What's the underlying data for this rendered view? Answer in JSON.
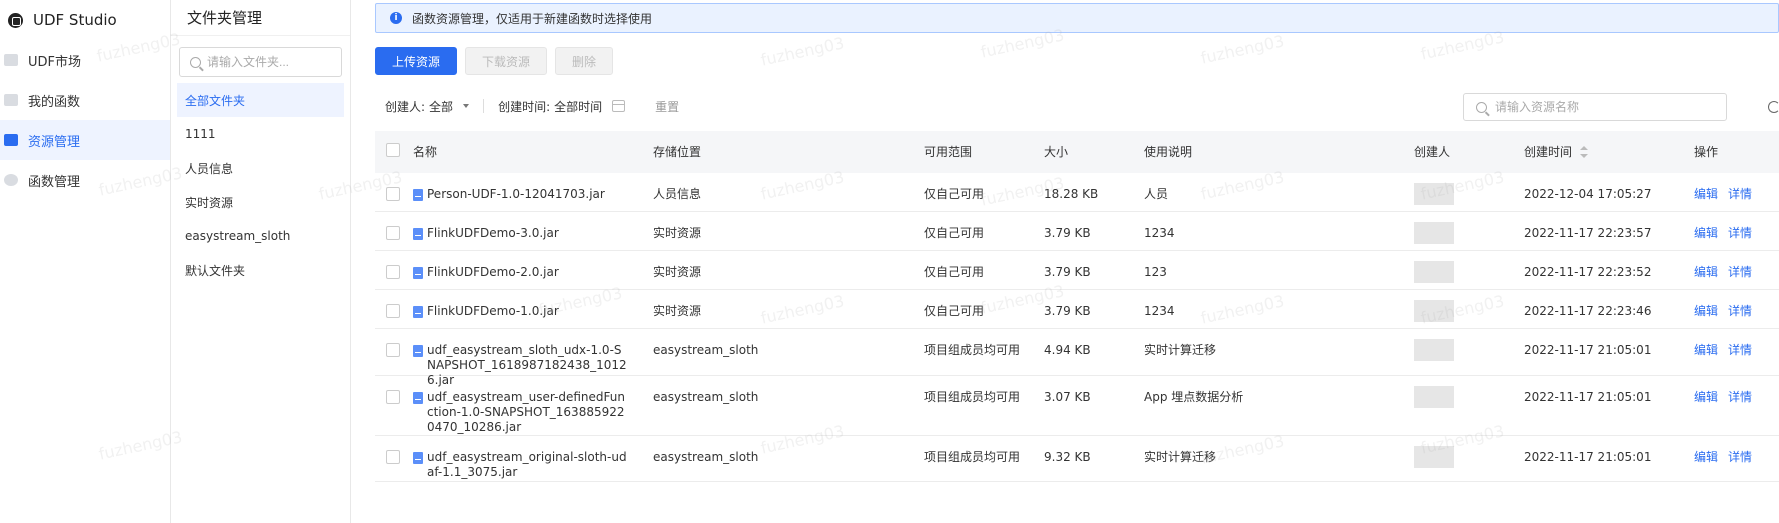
{
  "nav": {
    "brand": "UDF Studio",
    "items": [
      {
        "label": "UDF市场",
        "active": false
      },
      {
        "label": "我的函数",
        "active": false
      },
      {
        "label": "资源管理",
        "active": true
      },
      {
        "label": "函数管理",
        "active": false
      }
    ]
  },
  "folders": {
    "title": "文件夹管理",
    "search_placeholder": "请输入文件夹...",
    "items": [
      {
        "label": "全部文件夹",
        "active": true
      },
      {
        "label": "1111",
        "active": false
      },
      {
        "label": "人员信息",
        "active": false
      },
      {
        "label": "实时资源",
        "active": false
      },
      {
        "label": "easystream_sloth",
        "active": false
      },
      {
        "label": "默认文件夹",
        "active": false
      }
    ]
  },
  "banner": {
    "text": "函数资源管理，仅适用于新建函数时选择使用"
  },
  "toolbar": {
    "upload": "上传资源",
    "download": "下载资源",
    "delete": "删除"
  },
  "filters": {
    "creator_label": "创建人:",
    "creator_value": "全部",
    "time_label": "创建时间:",
    "time_value": "全部时间",
    "reset": "重置"
  },
  "resource_search": {
    "placeholder": "请输入资源名称"
  },
  "table": {
    "headers": {
      "name": "名称",
      "location": "存储位置",
      "scope": "可用范围",
      "size": "大小",
      "description": "使用说明",
      "creator": "创建人",
      "created_time": "创建时间",
      "ops": "操作"
    },
    "ops": {
      "edit": "编辑",
      "detail": "详情"
    },
    "rows": [
      {
        "name": "Person-UDF-1.0-12041703.jar",
        "location": "人员信息",
        "scope": "仅自己可用",
        "size": "18.28 KB",
        "description": "人员",
        "created_time": "2022-12-04 17:05:27"
      },
      {
        "name": "FlinkUDFDemo-3.0.jar",
        "location": "实时资源",
        "scope": "仅自己可用",
        "size": "3.79 KB",
        "description": "1234",
        "created_time": "2022-11-17 22:23:57"
      },
      {
        "name": "FlinkUDFDemo-2.0.jar",
        "location": "实时资源",
        "scope": "仅自己可用",
        "size": "3.79 KB",
        "description": "123",
        "created_time": "2022-11-17 22:23:52"
      },
      {
        "name": "FlinkUDFDemo-1.0.jar",
        "location": "实时资源",
        "scope": "仅自己可用",
        "size": "3.79 KB",
        "description": "1234",
        "created_time": "2022-11-17 22:23:46"
      },
      {
        "name": "udf_easystream_sloth_udx-1.0-SNAPSHOT_1618987182438_10126.jar",
        "location": "easystream_sloth",
        "scope": "项目组成员均可用",
        "size": "4.94 KB",
        "description": "实时计算迁移",
        "created_time": "2022-11-17 21:05:01"
      },
      {
        "name": "udf_easystream_user-definedFunction-1.0-SNAPSHOT_1638859220470_10286.jar",
        "location": "easystream_sloth",
        "scope": "项目组成员均可用",
        "size": "3.07 KB",
        "description": "App 埋点数据分析",
        "created_time": "2022-11-17 21:05:01"
      },
      {
        "name": "udf_easystream_original-sloth-udaf-1.1_3075.jar",
        "location": "easystream_sloth",
        "scope": "项目组成员均可用",
        "size": "9.32 KB",
        "description": "实时计算迁移",
        "created_time": "2022-11-17 21:05:01"
      }
    ]
  },
  "watermark": "fuzheng03"
}
